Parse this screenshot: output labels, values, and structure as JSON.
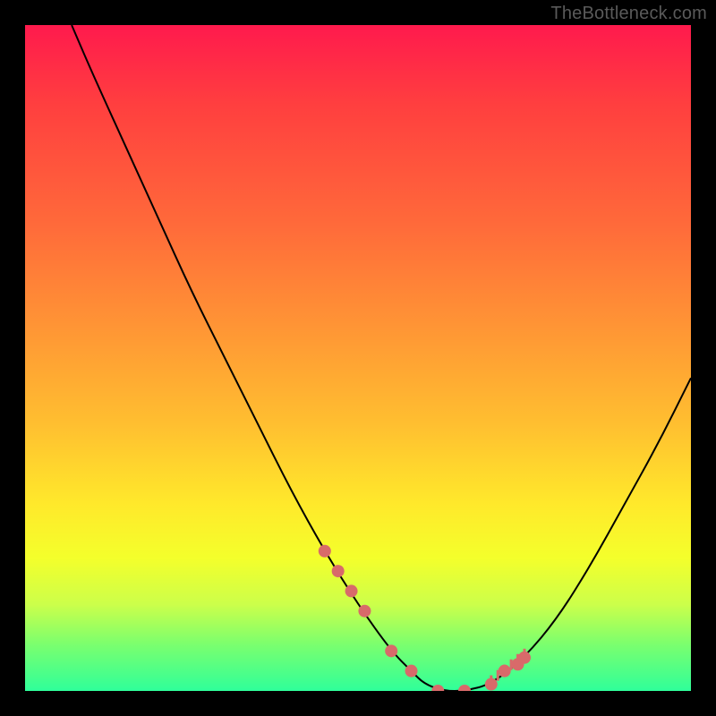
{
  "watermark": "TheBottleneck.com",
  "colors": {
    "background": "#000000",
    "curve_stroke": "#000000",
    "marker_fill": "#d86a6a",
    "tick_stroke": "#d86a6a",
    "gradient_top": "#ff1a4d",
    "gradient_bottom": "#2fff9a"
  },
  "chart_data": {
    "type": "line",
    "title": "",
    "xlabel": "",
    "ylabel": "",
    "xlim": [
      0,
      100
    ],
    "ylim": [
      0,
      100
    ],
    "series": [
      {
        "name": "bottleneck-curve",
        "x": [
          7,
          10,
          15,
          20,
          25,
          30,
          35,
          40,
          45,
          50,
          55,
          58,
          60,
          63,
          66,
          70,
          75,
          80,
          85,
          90,
          95,
          100
        ],
        "values": [
          100,
          93,
          82,
          71,
          60,
          50,
          40,
          30,
          21,
          13,
          6,
          3,
          1,
          0,
          0,
          1,
          5,
          11,
          19,
          28,
          37,
          47
        ]
      }
    ],
    "markers": {
      "name": "highlighted-points",
      "x": [
        45,
        47,
        49,
        51,
        55,
        58,
        62,
        66,
        70,
        72,
        74,
        75
      ],
      "values": [
        21,
        18,
        15,
        12,
        6,
        3,
        0,
        0,
        1,
        3,
        4,
        5
      ]
    },
    "ticks": {
      "x": [
        70,
        71,
        72,
        73,
        74,
        75
      ],
      "height": 3
    }
  }
}
